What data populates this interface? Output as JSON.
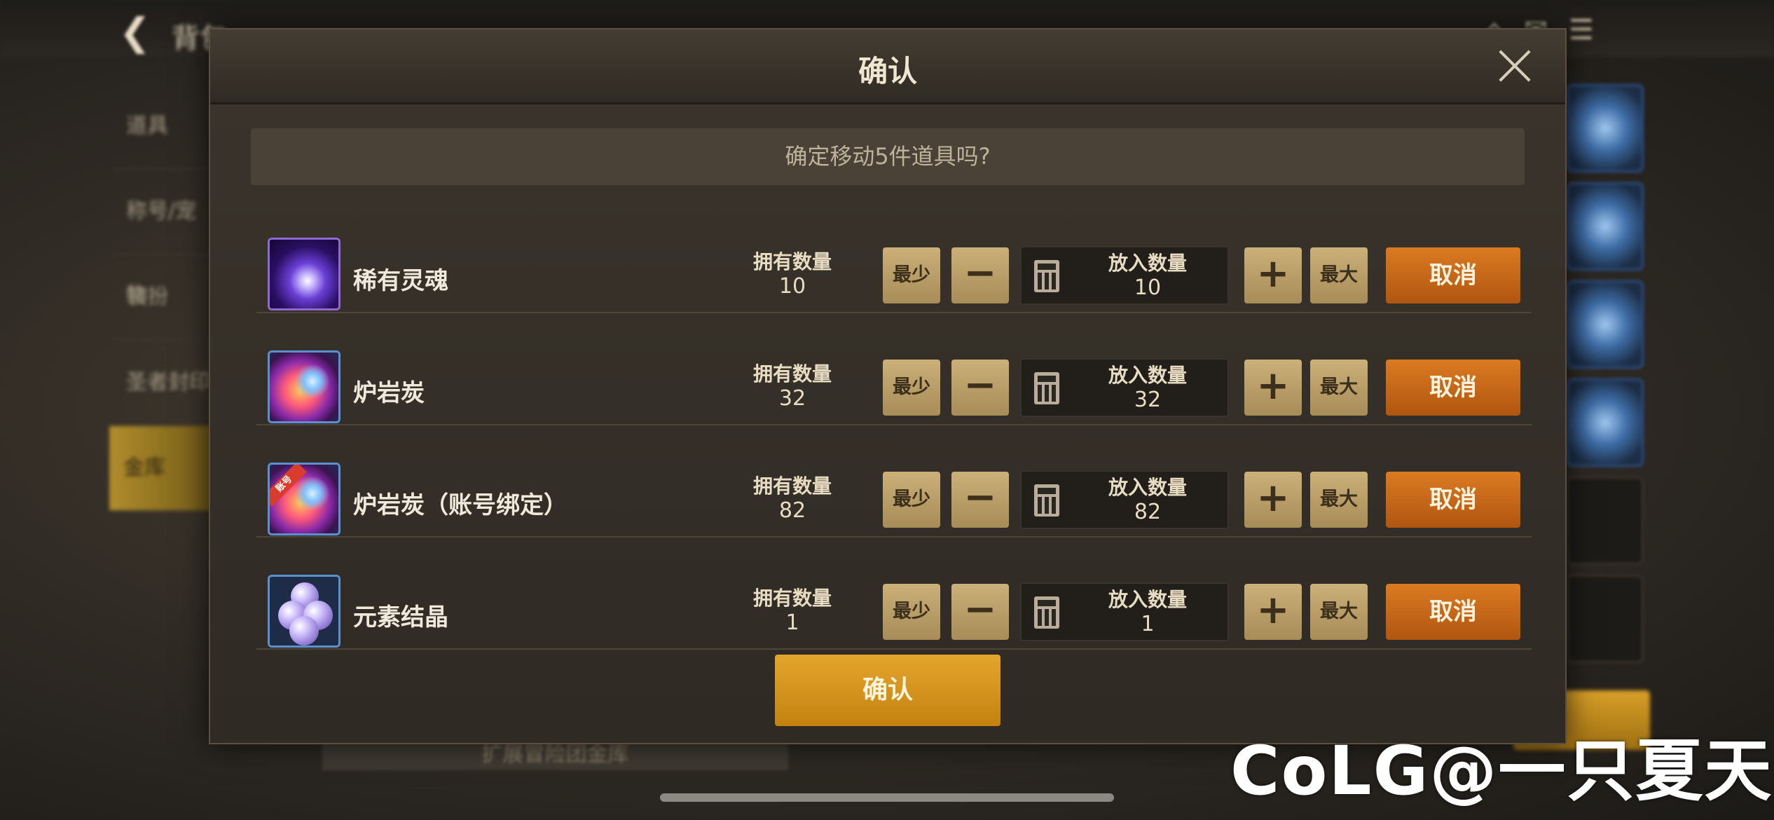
{
  "background": {
    "title": "背包",
    "sidebar": [
      "道具",
      "称号/宠物",
      "装扮",
      "圣者封印",
      "金库"
    ],
    "bottom_button": "扩展冒险团金库"
  },
  "dialog": {
    "title": "确认",
    "message": "确定移动5件道具吗?",
    "labels": {
      "owned": "拥有数量",
      "put": "放入数量",
      "min": "最少",
      "max": "最大",
      "minus": "−",
      "plus": "+",
      "cancel": "取消"
    },
    "items": [
      {
        "name": "稀有灵魂",
        "owned": "10",
        "put": "10",
        "icon": "rare-soul-icon"
      },
      {
        "name": "炉岩炭",
        "owned": "32",
        "put": "32",
        "icon": "lava-charcoal-icon"
      },
      {
        "name": "炉岩炭（账号绑定）",
        "owned": "82",
        "put": "82",
        "icon": "lava-charcoal-bound-icon",
        "badge": "账号"
      },
      {
        "name": "元素结晶",
        "owned": "1",
        "put": "1",
        "icon": "element-crystal-icon"
      }
    ],
    "confirm_label": "确认"
  },
  "watermark": "CoLG@一只夏天",
  "colors": {
    "accent_gold": "#e4a52c",
    "cancel_orange": "#db7a22",
    "stepper_tan": "#ccb07a"
  }
}
